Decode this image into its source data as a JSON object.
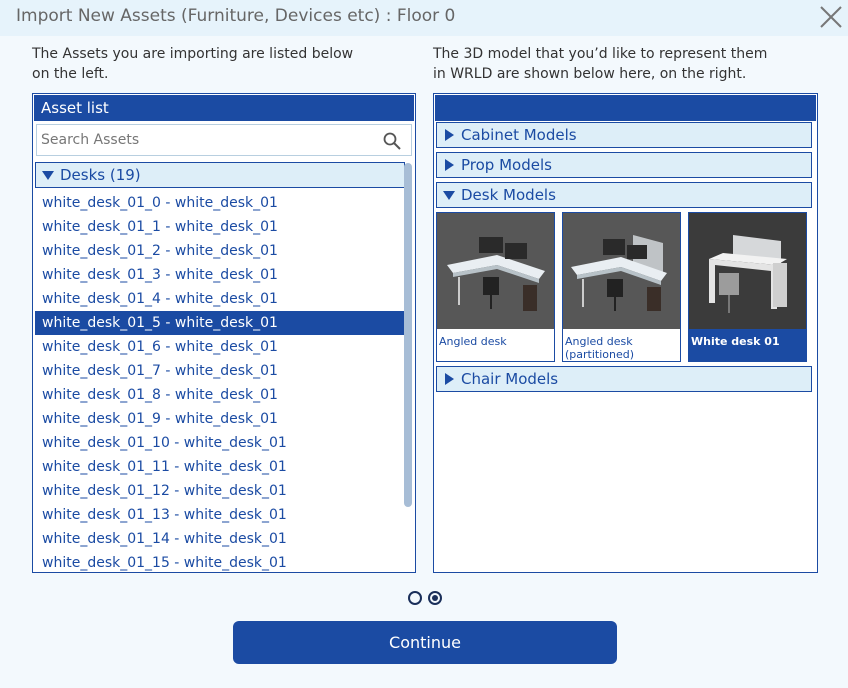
{
  "title": "Import New Assets (Furniture, Devices etc) : Floor 0",
  "left_intro": [
    "The Assets you are importing are listed below",
    "on the left."
  ],
  "right_intro": [
    "The 3D model that you’d like to represent them",
    "in WRLD are shown below here, on the right."
  ],
  "asset_panel": {
    "header": "Asset list",
    "search_placeholder": "Search Assets",
    "group_label": "Desks (19)",
    "items": [
      "white_desk_01_0 - white_desk_01",
      "white_desk_01_1 - white_desk_01",
      "white_desk_01_2 - white_desk_01",
      "white_desk_01_3 - white_desk_01",
      "white_desk_01_4 - white_desk_01",
      "white_desk_01_5 - white_desk_01",
      "white_desk_01_6 - white_desk_01",
      "white_desk_01_7 - white_desk_01",
      "white_desk_01_8 - white_desk_01",
      "white_desk_01_9 - white_desk_01",
      "white_desk_01_10 - white_desk_01",
      "white_desk_01_11 - white_desk_01",
      "white_desk_01_12 - white_desk_01",
      "white_desk_01_13 - white_desk_01",
      "white_desk_01_14 - white_desk_01",
      "white_desk_01_15 - white_desk_01"
    ],
    "selected_index": 5
  },
  "model_panel": {
    "header": "",
    "groups": {
      "cabinet": "Cabinet Models",
      "prop": "Prop Models",
      "desk": "Desk Models",
      "chair": "Chair Models"
    },
    "desk_models": [
      {
        "label": "Angled desk",
        "selected": false
      },
      {
        "label": "Angled desk (partitioned)",
        "selected": false
      },
      {
        "label": "White desk 01",
        "selected": true
      }
    ]
  },
  "pagination": {
    "pages": 2,
    "current": 2
  },
  "continue_label": "Continue",
  "colors": {
    "accent": "#1b4ba3",
    "background": "#f3f9fd",
    "group_bg": "#ddeef8"
  }
}
